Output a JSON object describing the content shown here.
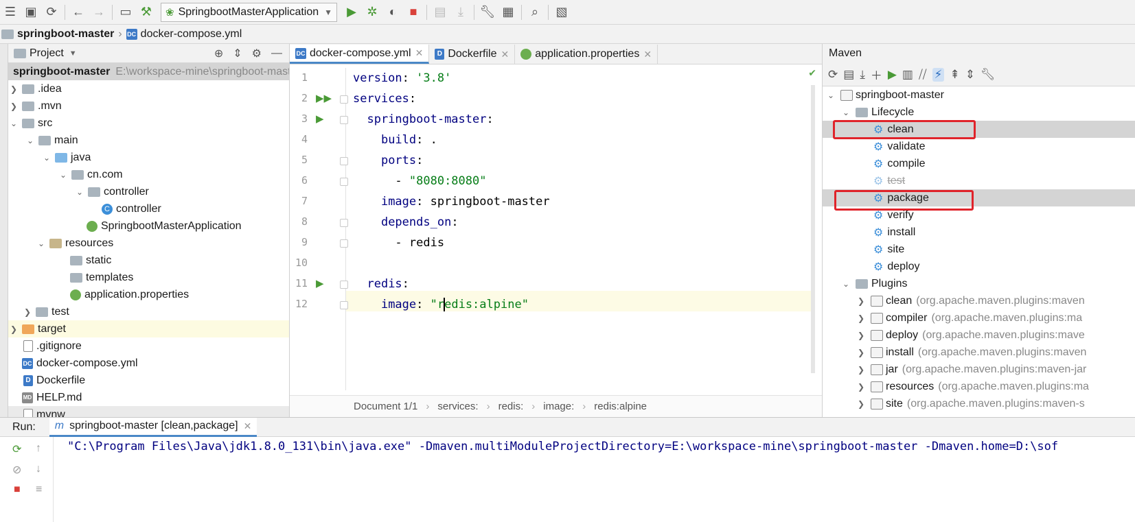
{
  "toolbar": {
    "run_config": "SpringbootMasterApplication",
    "icons": [
      "menu-icon",
      "save-icon",
      "sync-icon",
      "back-icon",
      "forward-icon",
      "terminal-icon",
      "build-icon",
      "run-icon",
      "debug-icon",
      "coverage-icon",
      "stop-icon",
      "attach-icon",
      "update-icon",
      "settings-icon",
      "project-structure-icon",
      "search-icon",
      "tasks-icon"
    ]
  },
  "breadcrumb": {
    "project": "springboot-master",
    "file": "docker-compose.yml"
  },
  "project_panel": {
    "title": "Project",
    "root_name": "springboot-master",
    "root_path": "E:\\workspace-mine\\springboot-mast",
    "items": [
      {
        "label": ".idea"
      },
      {
        "label": ".mvn"
      },
      {
        "label": "src"
      },
      {
        "label": "main"
      },
      {
        "label": "java"
      },
      {
        "label": "cn.com"
      },
      {
        "label": "controller"
      },
      {
        "label": "controller"
      },
      {
        "label": "SpringbootMasterApplication"
      },
      {
        "label": "resources"
      },
      {
        "label": "static"
      },
      {
        "label": "templates"
      },
      {
        "label": "application.properties"
      },
      {
        "label": "test"
      },
      {
        "label": "target"
      },
      {
        "label": ".gitignore"
      },
      {
        "label": "docker-compose.yml"
      },
      {
        "label": "Dockerfile"
      },
      {
        "label": "HELP.md"
      },
      {
        "label": "mvnw"
      }
    ]
  },
  "editor": {
    "tabs": [
      {
        "label": "docker-compose.yml",
        "icon": "dc"
      },
      {
        "label": "Dockerfile",
        "icon": "d"
      },
      {
        "label": "application.properties",
        "icon": "spring"
      }
    ],
    "line_numbers": [
      "1",
      "2",
      "3",
      "4",
      "5",
      "6",
      "7",
      "8",
      "9",
      "10",
      "11",
      "12"
    ],
    "lines": {
      "l1_key": "version",
      "l1_val": "'3.8'",
      "l2_key": "services",
      "l3_key": "springboot-master",
      "l4_key": "build",
      "l4_val": ".",
      "l5_key": "ports",
      "l6_val": "\"8080:8080\"",
      "l7_key": "image",
      "l7_val": "springboot-master",
      "l8_key": "depends_on",
      "l9_val": "redis",
      "l11_key": "redis",
      "l12_key": "image",
      "l12_val_a": "\"r",
      "l12_val_b": "edis:alpine\""
    },
    "status": {
      "doc": "Document 1/1",
      "path": [
        "services:",
        "redis:",
        "image:",
        "redis:alpine"
      ]
    }
  },
  "maven": {
    "title": "Maven",
    "project": "springboot-master",
    "lifecycle_label": "Lifecycle",
    "lifecycle": [
      "clean",
      "validate",
      "compile",
      "test",
      "package",
      "verify",
      "install",
      "site",
      "deploy"
    ],
    "plugins_label": "Plugins",
    "plugins": [
      {
        "name": "clean",
        "coord": "(org.apache.maven.plugins:maven"
      },
      {
        "name": "compiler",
        "coord": "(org.apache.maven.plugins:ma"
      },
      {
        "name": "deploy",
        "coord": "(org.apache.maven.plugins:mave"
      },
      {
        "name": "install",
        "coord": "(org.apache.maven.plugins:maven"
      },
      {
        "name": "jar",
        "coord": "(org.apache.maven.plugins:maven-jar"
      },
      {
        "name": "resources",
        "coord": "(org.apache.maven.plugins:ma"
      },
      {
        "name": "site",
        "coord": "(org.apache.maven.plugins:maven-s"
      }
    ]
  },
  "run": {
    "label": "Run:",
    "tab": "springboot-master [clean,package]",
    "console": "\"C:\\Program Files\\Java\\jdk1.8.0_131\\bin\\java.exe\" -Dmaven.multiModuleProjectDirectory=E:\\workspace-mine\\springboot-master -Dmaven.home=D:\\sof"
  }
}
